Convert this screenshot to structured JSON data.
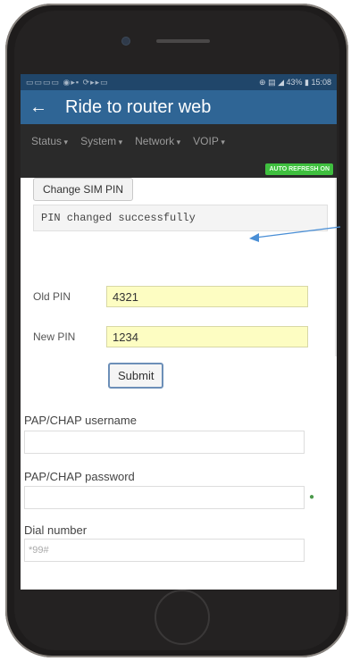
{
  "statusbar": {
    "left_icons": "▭▭▭▭ ◉▸▪ ⟳▸▸▭",
    "right": "⊕ ▤ ◢ 43% ▮ 15:08"
  },
  "appbar": {
    "back_icon": "←",
    "title": "Ride to router web"
  },
  "menu": {
    "items": [
      "Status",
      "System",
      "Network",
      "VOIP"
    ]
  },
  "badge": "AUTO REFRESH ON",
  "sim_button": "Change SIM PIN",
  "alert": "PIN changed successfully",
  "pin": {
    "old_label": "Old PIN",
    "old_value": "4321",
    "new_label": "New PIN",
    "new_value": "1234",
    "submit": "Submit"
  },
  "fields": {
    "pap_user_label": "PAP/CHAP username",
    "pap_user_value": "",
    "pap_pass_label": "PAP/CHAP password",
    "pap_pass_value": "",
    "dial_label": "Dial number",
    "dial_placeholder": "*99#"
  },
  "colors": {
    "appbar": "#2f6595",
    "statusbar": "#20466a",
    "badge": "#3fbf3f",
    "pin_input": "#fdfdc2",
    "arrow": "#4a8fd6"
  }
}
